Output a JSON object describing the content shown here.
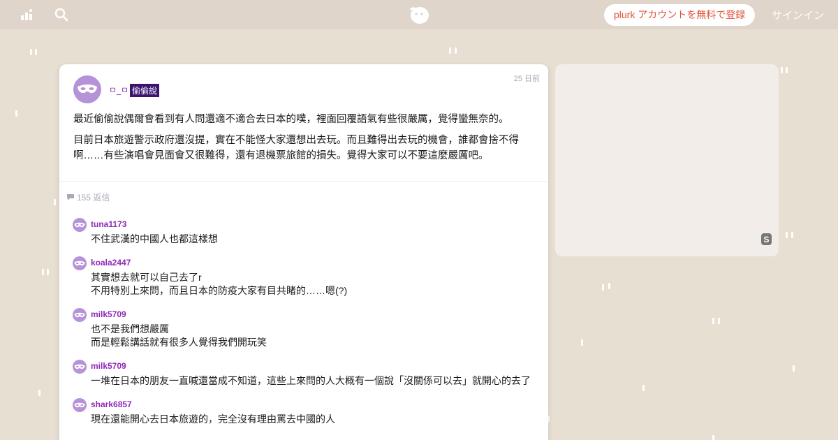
{
  "topbar": {
    "signup_label": "plurk アカウントを無料で登録",
    "signin_label": "サインイン",
    "icons": [
      "chart-icon",
      "search-icon",
      "plurk-logo"
    ]
  },
  "post": {
    "author": "ㅁ_ㅁ",
    "qualifier": "偷偷說",
    "time": "25 日前",
    "paragraphs": [
      "最近偷偷說偶爾會看到有人問還適不適合去日本的噗，裡面回覆語氣有些很嚴厲，覺得蠻無奈的。",
      "目前日本旅遊警示政府還沒提，實在不能怪大家還想出去玩。而且難得出去玩的機會，誰都會捨不得啊……有些演唱會見面會又很難得，還有退機票旅館的損失。覺得大家可以不要這麼嚴厲吧。"
    ],
    "response_count": "155 返信"
  },
  "responses": [
    {
      "name": "tuna1173",
      "lines": [
        "不住武漢的中國人也都這樣想"
      ]
    },
    {
      "name": "koala2447",
      "lines": [
        "其實想去就可以自己去了r",
        "不用特別上來問，而且日本的防疫大家有目共睹的……嗯(?)"
      ]
    },
    {
      "name": "milk5709",
      "lines": [
        "也不是我們想嚴厲",
        "而是輕鬆講話就有很多人覺得我們開玩笑"
      ]
    },
    {
      "name": "milk5709",
      "lines": [
        "一堆在日本的朋友一直喊還當成不知道，這些上來問的人大概有一個說「沒關係可以去」就開心的去了"
      ]
    },
    {
      "name": "shark6857",
      "lines": [
        "現在還能開心去日本旅遊的，完全沒有理由罵去中國的人"
      ]
    }
  ],
  "side": {
    "badge": "S"
  },
  "colors": {
    "background": "#e8dfd3",
    "signup_text": "#e0543a",
    "author": "#8d2ab8",
    "qualifier_bg": "#3b1470",
    "avatar": "#b692d8"
  }
}
